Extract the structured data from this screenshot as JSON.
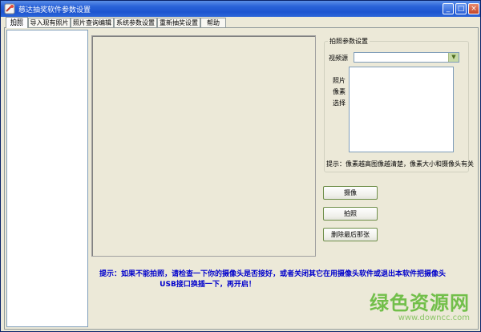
{
  "window": {
    "title": "慈达抽奖软件参数设置",
    "buttons": {
      "minimize": "_",
      "maximize": "□",
      "close": "×"
    }
  },
  "tabs": [
    {
      "label": "拍照",
      "active": true
    },
    {
      "label": "导入现有照片",
      "active": false
    },
    {
      "label": "照片查询编辑",
      "active": false
    },
    {
      "label": "系统参数设置",
      "active": false
    },
    {
      "label": "重新抽奖设置",
      "active": false
    },
    {
      "label": "帮助",
      "active": false
    }
  ],
  "photo_settings": {
    "group_title": "拍照参数设置",
    "video_source_label": "视频源",
    "video_source_value": "",
    "pixel_label_lines": [
      "照片",
      "像素",
      "选择"
    ],
    "hint": "提示：像素越高图像越清楚，像素大小和摄像头有关"
  },
  "actions": {
    "capture_label": "摄像",
    "photo_label": "拍照",
    "delete_last_label": "删除最后那张"
  },
  "bottom_hint": {
    "line1": "提示：如果不能拍照，请检查一下你的摄像头是否接好，或者关闭其它在用摄像头软件或退出本软件把摄像头",
    "line2": "USB接口换插一下，再开启！"
  },
  "watermark": {
    "brand": "绿色资源网",
    "url": "www.downcc.com"
  },
  "colors": {
    "hint_text": "#0000CC",
    "titlebar": "#1D55D0",
    "watermark": "#5DB832"
  }
}
